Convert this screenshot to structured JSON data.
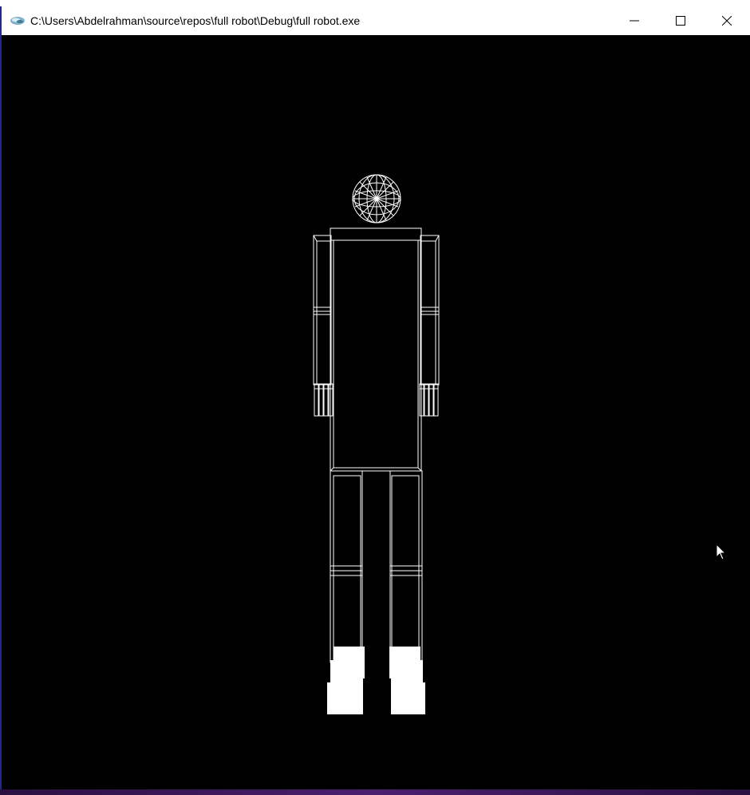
{
  "window": {
    "title": "C:\\Users\\Abdelrahman\\source\\repos\\full robot\\Debug\\full robot.exe",
    "app_icon": "glut-app-icon",
    "controls": {
      "minimize": "minimize-icon",
      "maximize": "maximize-icon",
      "close": "close-icon"
    }
  },
  "scene": {
    "background": "#000000",
    "line_color": "#ffffff",
    "render_mode": "wireframe",
    "parts": [
      "head",
      "torso",
      "left-arm",
      "right-arm",
      "left-hand",
      "right-hand",
      "left-leg",
      "right-leg",
      "left-foot",
      "right-foot"
    ]
  },
  "cursor": {
    "icon": "arrow-cursor-icon"
  }
}
